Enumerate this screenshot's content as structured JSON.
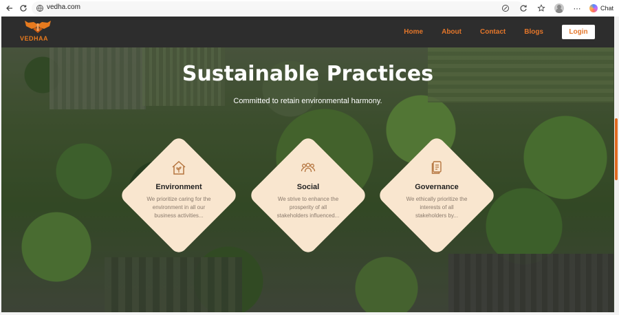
{
  "browser": {
    "url": "vedha.com",
    "chat_label": "Chat"
  },
  "header": {
    "logo_text": "VEDHAA",
    "nav": [
      "Home",
      "About",
      "Contact",
      "Blogs"
    ],
    "login_label": "Login"
  },
  "hero": {
    "title": "Sustainable Practices",
    "subtitle": "Committed to retain environmental harmony."
  },
  "cards": [
    {
      "icon": "house-leaf-icon",
      "title": "Environment",
      "text": "We prioritize caring for the environment in all our business activities..."
    },
    {
      "icon": "people-icon",
      "title": "Social",
      "text": "We strive to enhance the prosperity of all stakeholders influenced..."
    },
    {
      "icon": "document-icon",
      "title": "Governance",
      "text": "We ethically prioritize the interests of all stakeholders by..."
    }
  ],
  "colors": {
    "accent": "#e4762a",
    "header_bg": "#2d2d2d",
    "card_bg": "#f9e6cf"
  }
}
